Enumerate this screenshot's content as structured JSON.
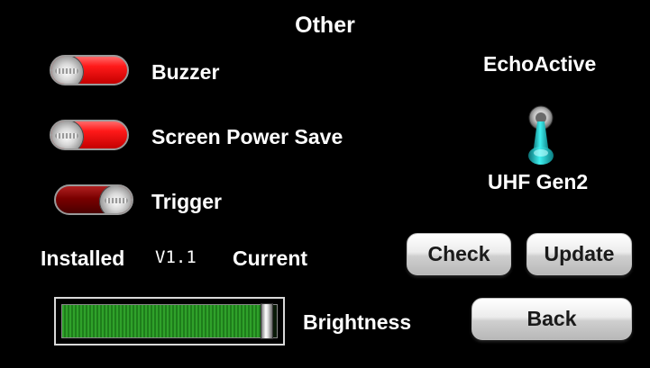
{
  "page": {
    "title": "Other"
  },
  "toggles": [
    {
      "label": "Buzzer",
      "state": "on"
    },
    {
      "label": "Screen Power Save",
      "state": "on"
    },
    {
      "label": "Trigger",
      "state": "off"
    }
  ],
  "version": {
    "installed_label": "Installed",
    "installed_value": "V1.1",
    "current_label": "Current"
  },
  "brightness": {
    "label": "Brightness",
    "level_percent": 96
  },
  "reader": {
    "mode_label": "EchoActive",
    "protocol_label": "UHF Gen2"
  },
  "buttons": {
    "check": "Check",
    "update": "Update",
    "back": "Back"
  },
  "colors": {
    "toggle_on": "#ff1a1a",
    "toggle_off": "#7a0000",
    "slider": "#2fa12a",
    "lever": "#2ad4d4"
  },
  "icons": {
    "lever": "lever-switch-icon",
    "knob": "toggle-knob-icon"
  }
}
